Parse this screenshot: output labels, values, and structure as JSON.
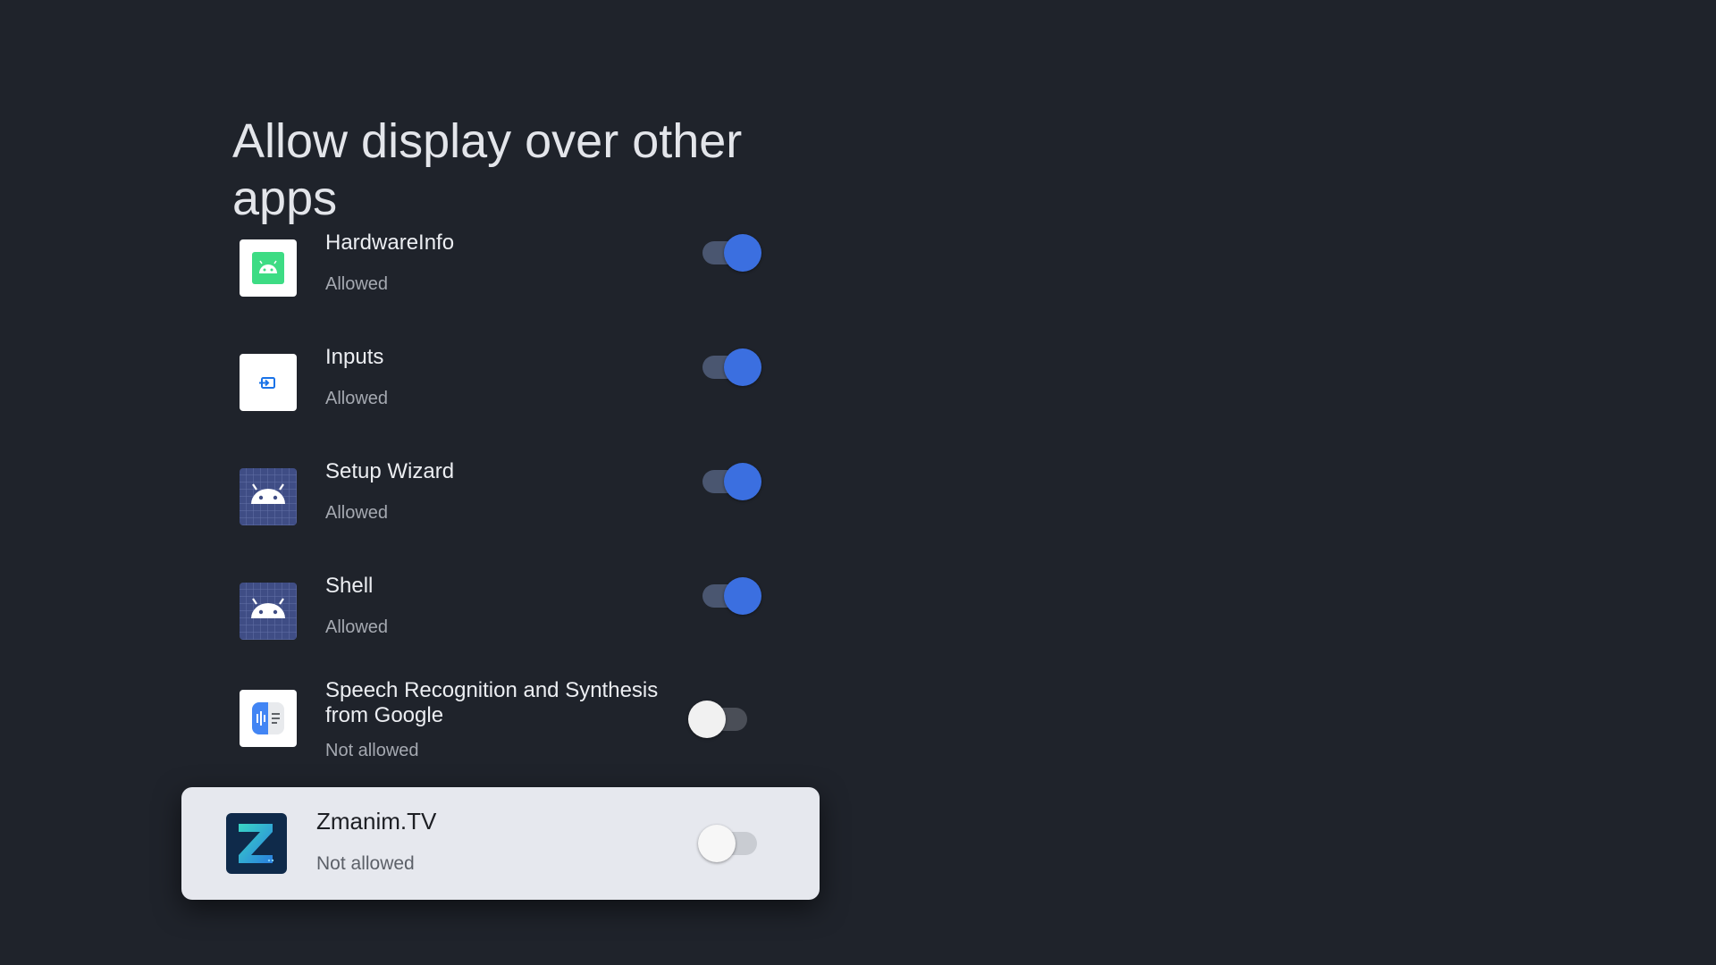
{
  "header": {
    "title": "Allow display over other apps"
  },
  "apps": [
    {
      "name": "HardwareInfo",
      "status": "Allowed",
      "enabled": true,
      "icon": "hardwareinfo-android-icon"
    },
    {
      "name": "Inputs",
      "status": "Allowed",
      "enabled": true,
      "icon": "inputs-icon"
    },
    {
      "name": "Setup Wizard",
      "status": "Allowed",
      "enabled": true,
      "icon": "android-robot-icon"
    },
    {
      "name": "Shell",
      "status": "Allowed",
      "enabled": true,
      "icon": "android-robot-icon"
    },
    {
      "name": "Speech Recognition and Synthesis from Google",
      "status": "Not allowed",
      "enabled": false,
      "icon": "speech-recognition-icon"
    },
    {
      "name": "Zmanim.TV",
      "status": "Not allowed",
      "enabled": false,
      "icon": "zmanim-logo-icon"
    }
  ],
  "colors": {
    "background": "#1f232b",
    "toggle_on": "#3b6fe0",
    "focused_row": "#e6e8ee"
  }
}
